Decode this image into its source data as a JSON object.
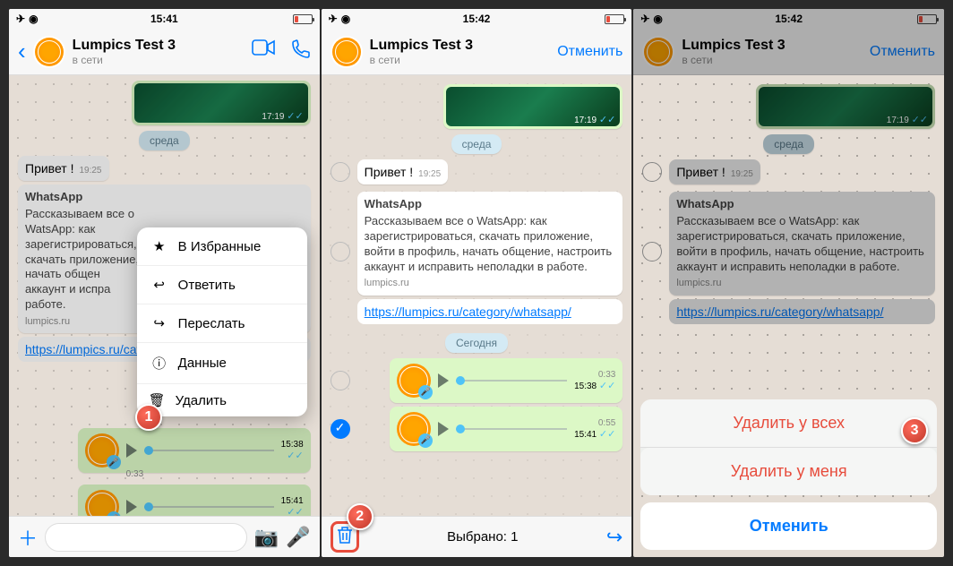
{
  "status": {
    "time1": "15:41",
    "time2": "15:42",
    "time3": "15:42"
  },
  "header": {
    "name": "Lumpics Test 3",
    "status": "в сети",
    "cancel": "Отменить"
  },
  "chat": {
    "day1": "среда",
    "day2": "Сегодня",
    "hello": "Привет !",
    "hello_time": "19:25",
    "link_title": "WhatsApp",
    "link_desc": "Рассказываем все о WatsApp: как зарегистрироваться, скачать приложение, войти в профиль, начать общение, настроить аккаунт и исправить неполадки в работе.",
    "link_desc_short": "Рассказываем все о WatsApp: как зарегистрироваться, скачать приложение, во\nначать общен\nаккаунт и испра\nработе.",
    "link_domain": "lumpics.ru",
    "link_url": "https://lumpics.ru/category/whatsapp/",
    "img_time": "17:19",
    "voice1_dur": "0:33",
    "voice1_time": "15:38",
    "voice2_dur": "0:55",
    "voice2_time": "15:41"
  },
  "menu": {
    "star": "В Избранные",
    "reply": "Ответить",
    "forward": "Переслать",
    "info": "Данные",
    "delete": "Удалить"
  },
  "footer": {
    "selected": "Выбрано: 1"
  },
  "sheet": {
    "delete_all": "Удалить у всех",
    "delete_me": "Удалить у меня",
    "cancel": "Отменить"
  },
  "badges": {
    "s1": "1",
    "s2": "2",
    "s3": "3"
  }
}
